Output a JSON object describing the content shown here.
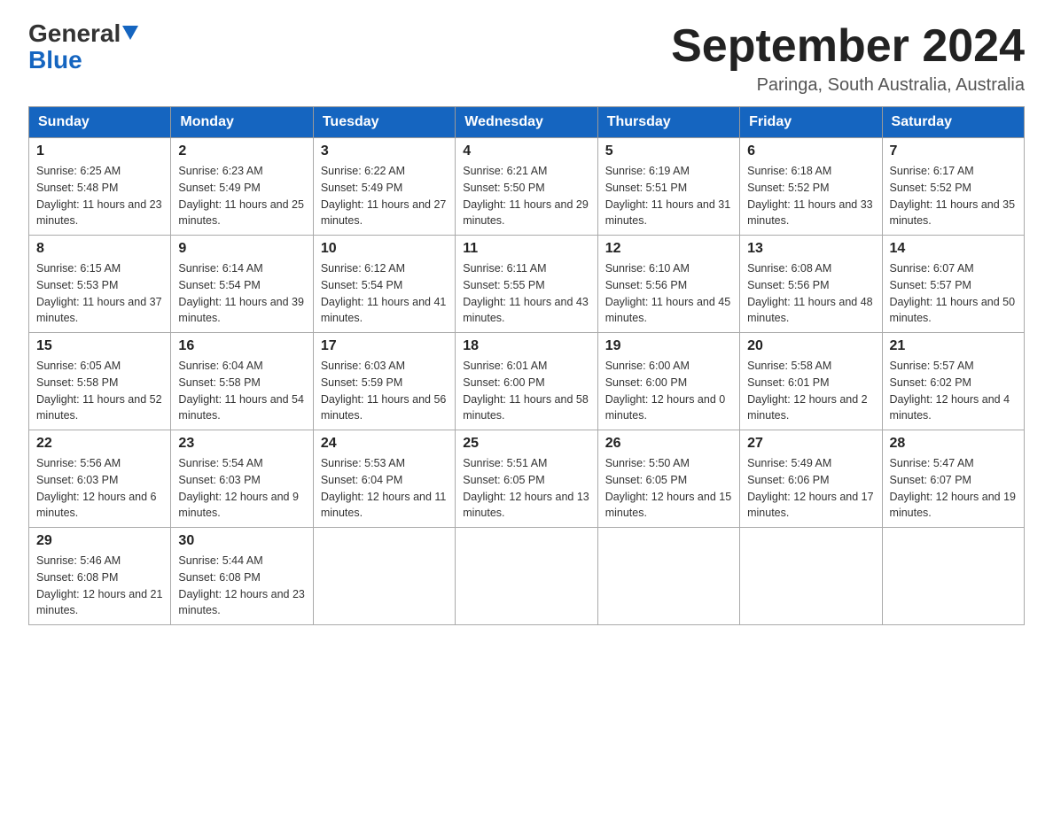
{
  "header": {
    "logo_general": "General",
    "logo_blue": "Blue",
    "month_title": "September 2024",
    "location": "Paringa, South Australia, Australia"
  },
  "days_of_week": [
    "Sunday",
    "Monday",
    "Tuesday",
    "Wednesday",
    "Thursday",
    "Friday",
    "Saturday"
  ],
  "weeks": [
    [
      {
        "day": "1",
        "sunrise": "6:25 AM",
        "sunset": "5:48 PM",
        "daylight": "11 hours and 23 minutes."
      },
      {
        "day": "2",
        "sunrise": "6:23 AM",
        "sunset": "5:49 PM",
        "daylight": "11 hours and 25 minutes."
      },
      {
        "day": "3",
        "sunrise": "6:22 AM",
        "sunset": "5:49 PM",
        "daylight": "11 hours and 27 minutes."
      },
      {
        "day": "4",
        "sunrise": "6:21 AM",
        "sunset": "5:50 PM",
        "daylight": "11 hours and 29 minutes."
      },
      {
        "day": "5",
        "sunrise": "6:19 AM",
        "sunset": "5:51 PM",
        "daylight": "11 hours and 31 minutes."
      },
      {
        "day": "6",
        "sunrise": "6:18 AM",
        "sunset": "5:52 PM",
        "daylight": "11 hours and 33 minutes."
      },
      {
        "day": "7",
        "sunrise": "6:17 AM",
        "sunset": "5:52 PM",
        "daylight": "11 hours and 35 minutes."
      }
    ],
    [
      {
        "day": "8",
        "sunrise": "6:15 AM",
        "sunset": "5:53 PM",
        "daylight": "11 hours and 37 minutes."
      },
      {
        "day": "9",
        "sunrise": "6:14 AM",
        "sunset": "5:54 PM",
        "daylight": "11 hours and 39 minutes."
      },
      {
        "day": "10",
        "sunrise": "6:12 AM",
        "sunset": "5:54 PM",
        "daylight": "11 hours and 41 minutes."
      },
      {
        "day": "11",
        "sunrise": "6:11 AM",
        "sunset": "5:55 PM",
        "daylight": "11 hours and 43 minutes."
      },
      {
        "day": "12",
        "sunrise": "6:10 AM",
        "sunset": "5:56 PM",
        "daylight": "11 hours and 45 minutes."
      },
      {
        "day": "13",
        "sunrise": "6:08 AM",
        "sunset": "5:56 PM",
        "daylight": "11 hours and 48 minutes."
      },
      {
        "day": "14",
        "sunrise": "6:07 AM",
        "sunset": "5:57 PM",
        "daylight": "11 hours and 50 minutes."
      }
    ],
    [
      {
        "day": "15",
        "sunrise": "6:05 AM",
        "sunset": "5:58 PM",
        "daylight": "11 hours and 52 minutes."
      },
      {
        "day": "16",
        "sunrise": "6:04 AM",
        "sunset": "5:58 PM",
        "daylight": "11 hours and 54 minutes."
      },
      {
        "day": "17",
        "sunrise": "6:03 AM",
        "sunset": "5:59 PM",
        "daylight": "11 hours and 56 minutes."
      },
      {
        "day": "18",
        "sunrise": "6:01 AM",
        "sunset": "6:00 PM",
        "daylight": "11 hours and 58 minutes."
      },
      {
        "day": "19",
        "sunrise": "6:00 AM",
        "sunset": "6:00 PM",
        "daylight": "12 hours and 0 minutes."
      },
      {
        "day": "20",
        "sunrise": "5:58 AM",
        "sunset": "6:01 PM",
        "daylight": "12 hours and 2 minutes."
      },
      {
        "day": "21",
        "sunrise": "5:57 AM",
        "sunset": "6:02 PM",
        "daylight": "12 hours and 4 minutes."
      }
    ],
    [
      {
        "day": "22",
        "sunrise": "5:56 AM",
        "sunset": "6:03 PM",
        "daylight": "12 hours and 6 minutes."
      },
      {
        "day": "23",
        "sunrise": "5:54 AM",
        "sunset": "6:03 PM",
        "daylight": "12 hours and 9 minutes."
      },
      {
        "day": "24",
        "sunrise": "5:53 AM",
        "sunset": "6:04 PM",
        "daylight": "12 hours and 11 minutes."
      },
      {
        "day": "25",
        "sunrise": "5:51 AM",
        "sunset": "6:05 PM",
        "daylight": "12 hours and 13 minutes."
      },
      {
        "day": "26",
        "sunrise": "5:50 AM",
        "sunset": "6:05 PM",
        "daylight": "12 hours and 15 minutes."
      },
      {
        "day": "27",
        "sunrise": "5:49 AM",
        "sunset": "6:06 PM",
        "daylight": "12 hours and 17 minutes."
      },
      {
        "day": "28",
        "sunrise": "5:47 AM",
        "sunset": "6:07 PM",
        "daylight": "12 hours and 19 minutes."
      }
    ],
    [
      {
        "day": "29",
        "sunrise": "5:46 AM",
        "sunset": "6:08 PM",
        "daylight": "12 hours and 21 minutes."
      },
      {
        "day": "30",
        "sunrise": "5:44 AM",
        "sunset": "6:08 PM",
        "daylight": "12 hours and 23 minutes."
      },
      null,
      null,
      null,
      null,
      null
    ]
  ]
}
